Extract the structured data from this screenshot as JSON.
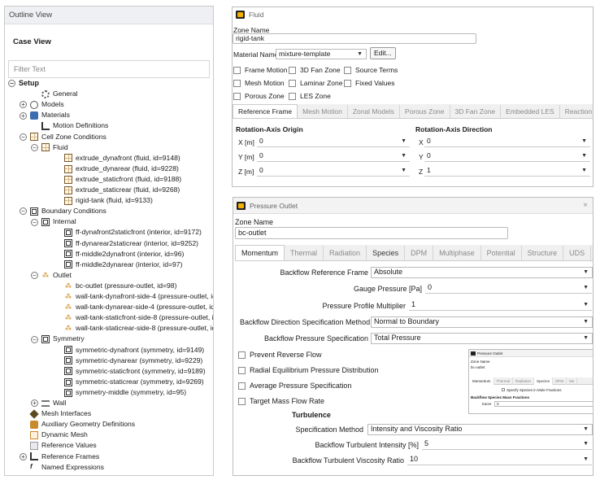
{
  "outline": {
    "title": "Outline View",
    "case_view": "Case View",
    "filter_placeholder": "Filter Text",
    "tree": [
      {
        "label": "Setup",
        "indent": 0,
        "toggle": "−",
        "icon": "none",
        "bold": true,
        "name": "tree-setup"
      },
      {
        "label": "General",
        "indent": 2,
        "toggle": "",
        "icon": "gear",
        "name": "tree-general"
      },
      {
        "label": "Models",
        "indent": 1,
        "toggle": "+",
        "icon": "atom",
        "name": "tree-models"
      },
      {
        "label": "Materials",
        "indent": 1,
        "toggle": "+",
        "icon": "mat",
        "name": "tree-materials"
      },
      {
        "label": "Motion Definitions",
        "indent": 2,
        "toggle": "",
        "icon": "motion",
        "name": "tree-motion-definitions"
      },
      {
        "label": "Cell Zone Conditions",
        "indent": 1,
        "toggle": "−",
        "icon": "grid",
        "name": "tree-cell-zone-conditions"
      },
      {
        "label": "Fluid",
        "indent": 2,
        "toggle": "−",
        "icon": "grid",
        "name": "tree-fluid"
      },
      {
        "label": "extrude_dynafront (fluid, id=9148)",
        "indent": 4,
        "toggle": "",
        "icon": "grid",
        "name": "tree-cell-zone"
      },
      {
        "label": "extrude_dynarear (fluid, id=9228)",
        "indent": 4,
        "toggle": "",
        "icon": "grid",
        "name": "tree-cell-zone"
      },
      {
        "label": "extrude_staticfront (fluid, id=9188)",
        "indent": 4,
        "toggle": "",
        "icon": "grid",
        "name": "tree-cell-zone"
      },
      {
        "label": "extrude_staticrear (fluid, id=9268)",
        "indent": 4,
        "toggle": "",
        "icon": "grid",
        "name": "tree-cell-zone"
      },
      {
        "label": "rigid-tank (fluid, id=9133)",
        "indent": 4,
        "toggle": "",
        "icon": "grid",
        "name": "tree-cell-zone"
      },
      {
        "label": "Boundary Conditions",
        "indent": 1,
        "toggle": "−",
        "icon": "box",
        "name": "tree-boundary-conditions"
      },
      {
        "label": "Internal",
        "indent": 2,
        "toggle": "−",
        "icon": "box",
        "name": "tree-internal"
      },
      {
        "label": "ff-dynafront2staticfront (interior, id=9172)",
        "indent": 4,
        "toggle": "",
        "icon": "box",
        "name": "tree-boundary-zone"
      },
      {
        "label": "ff-dynarear2staticrear (interior, id=9252)",
        "indent": 4,
        "toggle": "",
        "icon": "box",
        "name": "tree-boundary-zone"
      },
      {
        "label": "ff-middle2dynafront (interior, id=96)",
        "indent": 4,
        "toggle": "",
        "icon": "box",
        "name": "tree-boundary-zone"
      },
      {
        "label": "ff-middle2dynarear (interior, id=97)",
        "indent": 4,
        "toggle": "",
        "icon": "box",
        "name": "tree-boundary-zone"
      },
      {
        "label": "Outlet",
        "indent": 2,
        "toggle": "−",
        "icon": "outlet",
        "name": "tree-outlet"
      },
      {
        "label": "bc-outlet (pressure-outlet, id=98)",
        "indent": 4,
        "toggle": "",
        "icon": "outlet",
        "name": "tree-boundary-zone"
      },
      {
        "label": "wall-tank-dynafront-side-4 (pressure-outlet, id",
        "indent": 4,
        "toggle": "",
        "icon": "outlet",
        "name": "tree-boundary-zone"
      },
      {
        "label": "wall-tank-dynarear-side-4 (pressure-outlet, id",
        "indent": 4,
        "toggle": "",
        "icon": "outlet",
        "name": "tree-boundary-zone"
      },
      {
        "label": "wall-tank-staticfront-side-8 (pressure-outlet, i",
        "indent": 4,
        "toggle": "",
        "icon": "outlet",
        "name": "tree-boundary-zone"
      },
      {
        "label": "wall-tank-staticrear-side-8 (pressure-outlet, id",
        "indent": 4,
        "toggle": "",
        "icon": "outlet",
        "name": "tree-boundary-zone"
      },
      {
        "label": "Symmetry",
        "indent": 2,
        "toggle": "−",
        "icon": "box",
        "name": "tree-symmetry"
      },
      {
        "label": "symmetric-dynafront (symmetry, id=9149)",
        "indent": 4,
        "toggle": "",
        "icon": "box",
        "name": "tree-boundary-zone"
      },
      {
        "label": "symmetric-dynarear (symmetry, id=9229)",
        "indent": 4,
        "toggle": "",
        "icon": "box",
        "name": "tree-boundary-zone"
      },
      {
        "label": "symmetric-staticfront (symmetry, id=9189)",
        "indent": 4,
        "toggle": "",
        "icon": "box",
        "name": "tree-boundary-zone"
      },
      {
        "label": "symmetric-staticrear (symmetry, id=9269)",
        "indent": 4,
        "toggle": "",
        "icon": "box",
        "name": "tree-boundary-zone"
      },
      {
        "label": "symmetry-middle (symmetry, id=95)",
        "indent": 4,
        "toggle": "",
        "icon": "box",
        "name": "tree-boundary-zone"
      },
      {
        "label": "Wall",
        "indent": 2,
        "toggle": "+",
        "icon": "wall",
        "name": "tree-wall"
      },
      {
        "label": "Mesh Interfaces",
        "indent": 1,
        "toggle": "",
        "icon": "mesh",
        "name": "tree-mesh-interfaces"
      },
      {
        "label": "Auxiliary Geometry Definitions",
        "indent": 1,
        "toggle": "",
        "icon": "aux",
        "name": "tree-auxiliary-geometry"
      },
      {
        "label": "Dynamic Mesh",
        "indent": 1,
        "toggle": "",
        "icon": "dyn",
        "name": "tree-dynamic-mesh"
      },
      {
        "label": "Reference Values",
        "indent": 1,
        "toggle": "",
        "icon": "ref",
        "name": "tree-reference-values"
      },
      {
        "label": "Reference Frames",
        "indent": 1,
        "toggle": "+",
        "icon": "frames",
        "name": "tree-reference-frames"
      },
      {
        "label": "Named Expressions",
        "indent": 1,
        "toggle": "",
        "icon": "fx",
        "name": "tree-named-expressions"
      }
    ]
  },
  "fluid": {
    "title": "Fluid",
    "zone_name_label": "Zone Name",
    "zone_name_value": "rigid-tank",
    "material_name_label": "Material Name",
    "material_value": "mixture-template",
    "edit_button": "Edit...",
    "checkboxes": [
      {
        "label": "Frame Motion"
      },
      {
        "label": "3D Fan Zone"
      },
      {
        "label": "Source Terms"
      },
      {
        "label": "Mesh Motion"
      },
      {
        "label": "Laminar Zone"
      },
      {
        "label": "Fixed Values"
      },
      {
        "label": "Porous Zone"
      },
      {
        "label": "LES Zone"
      }
    ],
    "tabs": [
      "Reference Frame",
      "Mesh Motion",
      "Zonal Models",
      "Porous Zone",
      "3D Fan Zone",
      "Embedded LES",
      "Reaction",
      "S"
    ],
    "rotation_origin_title": "Rotation-Axis Origin",
    "rotation_direction_title": "Rotation-Axis Direction",
    "origin": [
      {
        "label": "X [m]",
        "value": "0"
      },
      {
        "label": "Y [m]",
        "value": "0"
      },
      {
        "label": "Z [m]",
        "value": "0"
      }
    ],
    "direction": [
      {
        "label": "X",
        "value": "0"
      },
      {
        "label": "Y",
        "value": "0"
      },
      {
        "label": "Z",
        "value": "1"
      }
    ]
  },
  "pressure_outlet": {
    "title": "Pressure Outlet",
    "close_icon": "×",
    "zone_name_label": "Zone Name",
    "zone_name_value": "bc-outlet",
    "tabs": [
      "Momentum",
      "Thermal",
      "Radiation",
      "Species",
      "DPM",
      "Multiphase",
      "Potential",
      "Structure",
      "UDS"
    ],
    "backflow_ref_frame_label": "Backflow Reference Frame",
    "backflow_ref_frame_value": "Absolute",
    "gauge_pressure_label": "Gauge Pressure [Pa]",
    "gauge_pressure_value": "0",
    "profile_multiplier_label": "Pressure Profile Multiplier",
    "profile_multiplier_value": "1",
    "backflow_dir_label": "Backflow Direction Specification Method",
    "backflow_dir_value": "Normal to Boundary",
    "backflow_pressure_label": "Backflow Pressure Specification",
    "backflow_pressure_value": "Total Pressure",
    "options": [
      {
        "label": "Prevent Reverse Flow"
      },
      {
        "label": "Radial Equilibrium Pressure Distribution"
      },
      {
        "label": "Average Pressure Specification"
      },
      {
        "label": "Target Mass Flow Rate"
      }
    ],
    "turbulence_title": "Turbulence",
    "spec_method_label": "Specification Method",
    "spec_method_value": "Intensity and Viscosity Ratio",
    "turb_intensity_label": "Backflow Turbulent Intensity [%]",
    "turb_intensity_value": "5",
    "turb_visc_label": "Backflow Turbulent Viscosity Ratio",
    "turb_visc_value": "10"
  },
  "mini": {
    "title": "Pressure Outlet",
    "zone_name_label": "Zone Name",
    "zone_name_value": "bc-outlet",
    "tabs": [
      "Momentum",
      "Thermal",
      "Radiation",
      "Species",
      "DPM",
      "Mu"
    ],
    "checkbox_label": "Specify Species in Mole Fractions",
    "section_title": "Backflow Species Mass Fractions",
    "tracer_label": "tracer",
    "tracer_value": "0"
  }
}
